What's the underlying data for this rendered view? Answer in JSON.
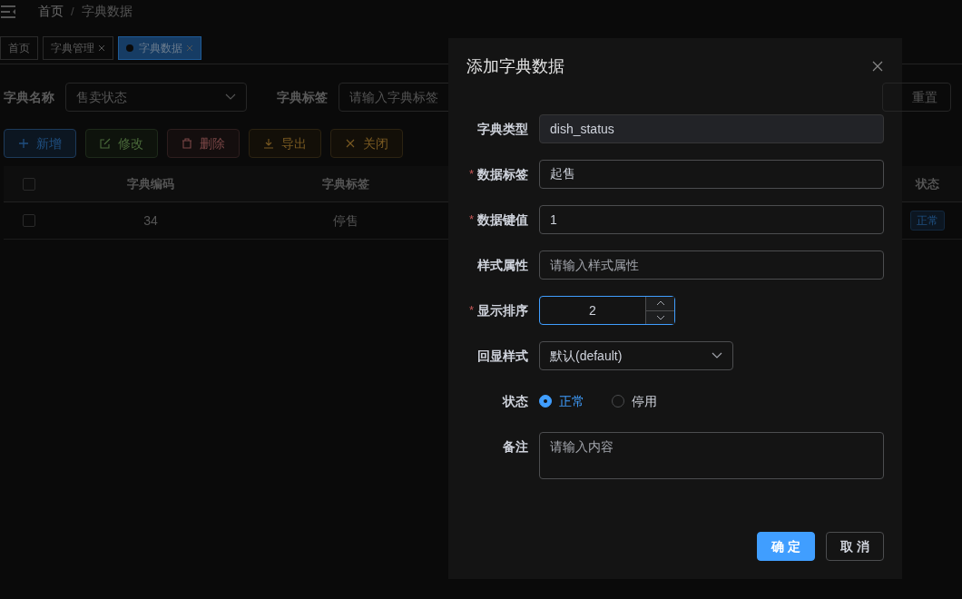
{
  "breadcrumb": [
    "首页",
    "/",
    "字典数据"
  ],
  "tabs": [
    {
      "label": "首页",
      "selected": false,
      "closable": false
    },
    {
      "label": "字典管理",
      "selected": false,
      "closable": true
    },
    {
      "label": "字典数据",
      "selected": true,
      "closable": true
    }
  ],
  "search": {
    "fields": [
      {
        "label": "字典名称",
        "kind": "select",
        "value": "售卖状态"
      },
      {
        "label": "字典标签",
        "kind": "input",
        "placeholder": "请输入字典标签"
      }
    ],
    "reset_button": "重置"
  },
  "toolbar": [
    {
      "label": "新增",
      "kind": "add"
    },
    {
      "label": "修改",
      "kind": "edit"
    },
    {
      "label": "删除",
      "kind": "delete"
    },
    {
      "label": "导出",
      "kind": "export"
    },
    {
      "label": "关闭",
      "kind": "close"
    }
  ],
  "table": {
    "select_all_checked": false,
    "columns": [
      "字典编码",
      "字典标签",
      "状态"
    ],
    "rows": [
      {
        "checked": false,
        "cells": [
          "34",
          "停售"
        ],
        "status": "正常"
      }
    ]
  },
  "dialog": {
    "title": "添加字典数据",
    "fields": [
      {
        "label": "字典类型",
        "kind": "input",
        "value": "dish_status",
        "disabled": true
      },
      {
        "label": "数据标签",
        "required_mark": "*",
        "kind": "input",
        "value": "起售",
        "disabled": false
      },
      {
        "label": "数据键值",
        "required_mark": "*",
        "kind": "input",
        "value": "1",
        "disabled": false
      },
      {
        "label": "样式属性",
        "kind": "input",
        "placeholder": "请输入样式属性",
        "disabled": false
      },
      {
        "label": "显示排序",
        "required_mark": "*",
        "kind": "number",
        "value": "2"
      },
      {
        "label": "回显样式",
        "kind": "select",
        "value": "默认(default)"
      },
      {
        "label": "状态",
        "kind": "radio",
        "options": [
          {
            "label": "正常",
            "selected": true
          },
          {
            "label": "停用",
            "selected": false
          }
        ]
      },
      {
        "label": "备注",
        "kind": "textarea",
        "placeholder": "请输入内容"
      }
    ],
    "buttons": [
      {
        "label": "确 定",
        "kind": "primary"
      },
      {
        "label": "取 消",
        "kind": "default"
      }
    ]
  }
}
